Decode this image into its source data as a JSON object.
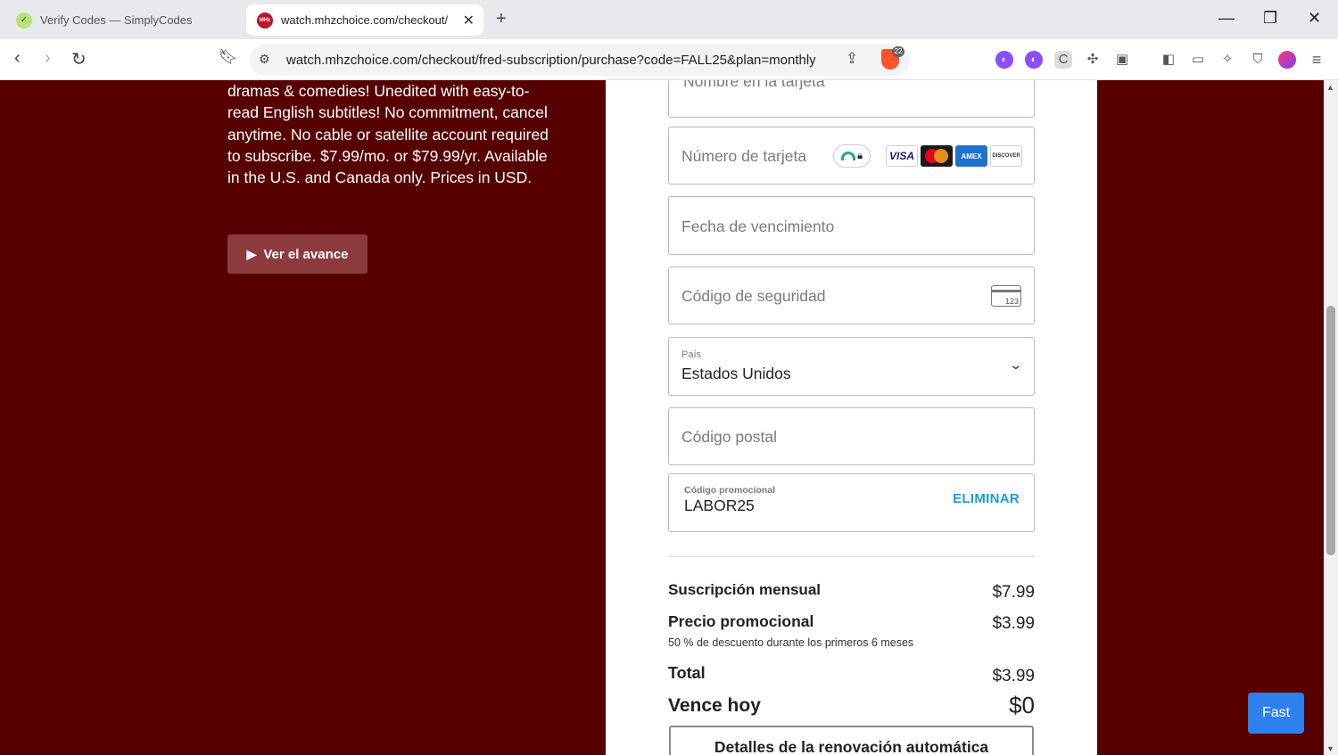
{
  "browser": {
    "tabs": [
      {
        "title": "Verify Codes — SimplyCodes",
        "favicon": "simplycodes-icon"
      },
      {
        "title": "watch.mhzchoice.com/checkout/",
        "favicon": "mhz-icon"
      }
    ],
    "url": "watch.mhzchoice.com/checkout/fred-subscription/purchase?code=FALL25&plan=monthly",
    "shields_count": "22"
  },
  "left": {
    "description": "dramas & comedies! Unedited with easy-to-read English subtitles! No commitment, cancel anytime. No cable or satellite account required to subscribe. $7.99/mo. or $79.99/yr. Available in the U.S. and Canada only. Prices in USD.",
    "trailer_label": "Ver el avance"
  },
  "form": {
    "name_placeholder": "Nombre en la tarjeta",
    "card_placeholder": "Número de tarjeta",
    "card_brands": [
      "VISA",
      "Mastercard",
      "AMEX",
      "DISCOVER"
    ],
    "expiry_placeholder": "Fecha de vencimiento",
    "cvc_placeholder": "Código de seguridad",
    "cvc_icon_text": "123",
    "country_label": "País",
    "country_value": "Estados Unidos",
    "zip_placeholder": "Código postal",
    "promo_label": "Código promocional",
    "promo_value": "LABOR25",
    "promo_remove": "ELIMINAR"
  },
  "summary": {
    "monthly_label": "Suscripción mensual",
    "monthly_value": "$7.99",
    "promo_label": "Precio promocional",
    "promo_value": "$3.99",
    "promo_note": "50 % de descuento durante los primeros 6 meses",
    "total_label": "Total",
    "total_value": "$3.99",
    "due_label": "Vence hoy",
    "due_value": "$0",
    "renewal_button": "Detalles de la renovación automática"
  },
  "fast_button": "Fast",
  "colors": {
    "background": "#560000",
    "trailer_button": "#8c3a3c",
    "link_blue": "#1a9bd6",
    "fast_blue": "#2f80ed"
  }
}
